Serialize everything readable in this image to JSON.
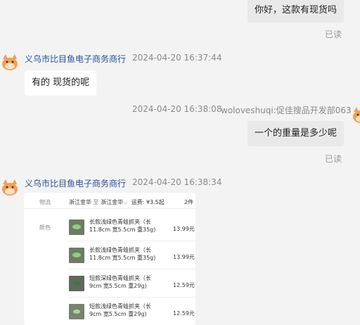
{
  "messages": {
    "m1": {
      "text": "你好，这款有现货吗",
      "status": "已读"
    },
    "m2": {
      "sender": "义乌市比目鱼电子商务商行",
      "time": "2024-04-20 16:37:44",
      "text": "有的 现货的呢"
    },
    "m3": {
      "time": "2024-04-20 16:38:08",
      "sender": "woloveshuqi:促佳搜品开发部063",
      "text": "一个的重量是多少呢",
      "status": "已读"
    },
    "m4": {
      "sender": "义乌市比目鱼电子商务商行",
      "time": "2024-04-20 16:38:34"
    }
  },
  "card": {
    "label_logistics": "物流",
    "origin": "浙江金华",
    "arrow": "至",
    "dest": "浙江金华",
    "freight": "运费: ¥3.5起",
    "extra": "2件",
    "label_color": "颜色",
    "items": [
      {
        "name": "长款浅绿色青蛙抓夹（长11.8cm 宽5.5cm 重35g)",
        "price": "13.99元"
      },
      {
        "name": "长款浅绿色青蛙抓夹（长11.8cm 宽5.5cm 重35g)",
        "price": "13.99元"
      },
      {
        "name": "短款深绿色青蛙抓夹（长9cm 宽5.5cm 重29g)",
        "price": "12.59元"
      },
      {
        "name": "短款浅绿色青蛙抓夹（长9cm 宽5.5cm 重29g)",
        "price": "12.59元"
      }
    ]
  },
  "colors": {
    "sender": "#2b4fa0",
    "background": "#f3f3f3",
    "self_bubble": "#e9e9e9",
    "avatar": "#f0a050"
  },
  "icons": {
    "avatar": "cartoon-creature-avatar"
  }
}
